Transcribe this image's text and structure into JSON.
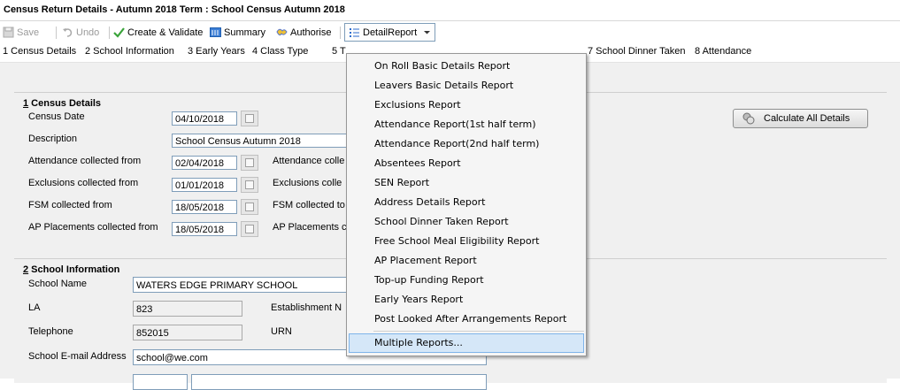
{
  "window": {
    "title": "Census Return Details - Autumn 2018 Term : School Census Autumn 2018"
  },
  "toolbar": {
    "save": "Save",
    "undo": "Undo",
    "create_validate": "Create & Validate",
    "summary": "Summary",
    "authorise": "Authorise",
    "detail_report": "DetailReport"
  },
  "tabs": [
    "1 Census Details",
    "2 School Information",
    "3 Early Years",
    "4 Class Type",
    "5 T",
    "7 School Dinner Taken",
    "8 Attendance"
  ],
  "census": {
    "title_num": "1",
    "title": " Census Details",
    "rows": [
      {
        "label": "Census Date",
        "value": "04/10/2018",
        "right_label": ""
      },
      {
        "label": "Description",
        "value": "School Census Autumn 2018",
        "right_label": ""
      },
      {
        "label": "Attendance collected from",
        "value": "02/04/2018",
        "right_label": "Attendance colle"
      },
      {
        "label": "Exclusions collected from",
        "value": "01/01/2018",
        "right_label": "Exclusions colle"
      },
      {
        "label": "FSM collected from",
        "value": "18/05/2018",
        "right_label": "FSM collected to"
      },
      {
        "label": "AP Placements collected from",
        "value": "18/05/2018",
        "right_label": "AP Placements c"
      }
    ],
    "calculate_button": "Calculate All Details"
  },
  "school": {
    "title_num": "2",
    "title": " School Information",
    "school_name_label": "School Name",
    "school_name": "WATERS EDGE PRIMARY SCHOOL",
    "la_label": "LA",
    "la": "823",
    "estab_label": "Establishment N",
    "telephone_label": "Telephone",
    "telephone": "852015",
    "urn_label": "URN",
    "email_label": "School E-mail Address",
    "email": "school@we.com"
  },
  "dropdown": {
    "items": [
      "On Roll Basic Details Report",
      "Leavers Basic Details Report",
      "Exclusions Report",
      "Attendance Report(1st half term)",
      "Attendance Report(2nd half term)",
      "Absentees Report",
      "SEN Report",
      "Address Details Report",
      "School Dinner Taken Report",
      "Free School Meal Eligibility Report",
      "AP Placement Report",
      "Top-up Funding Report",
      "Early Years Report",
      "Post Looked After Arrangements Report"
    ],
    "multiple": "Multiple Reports..."
  }
}
